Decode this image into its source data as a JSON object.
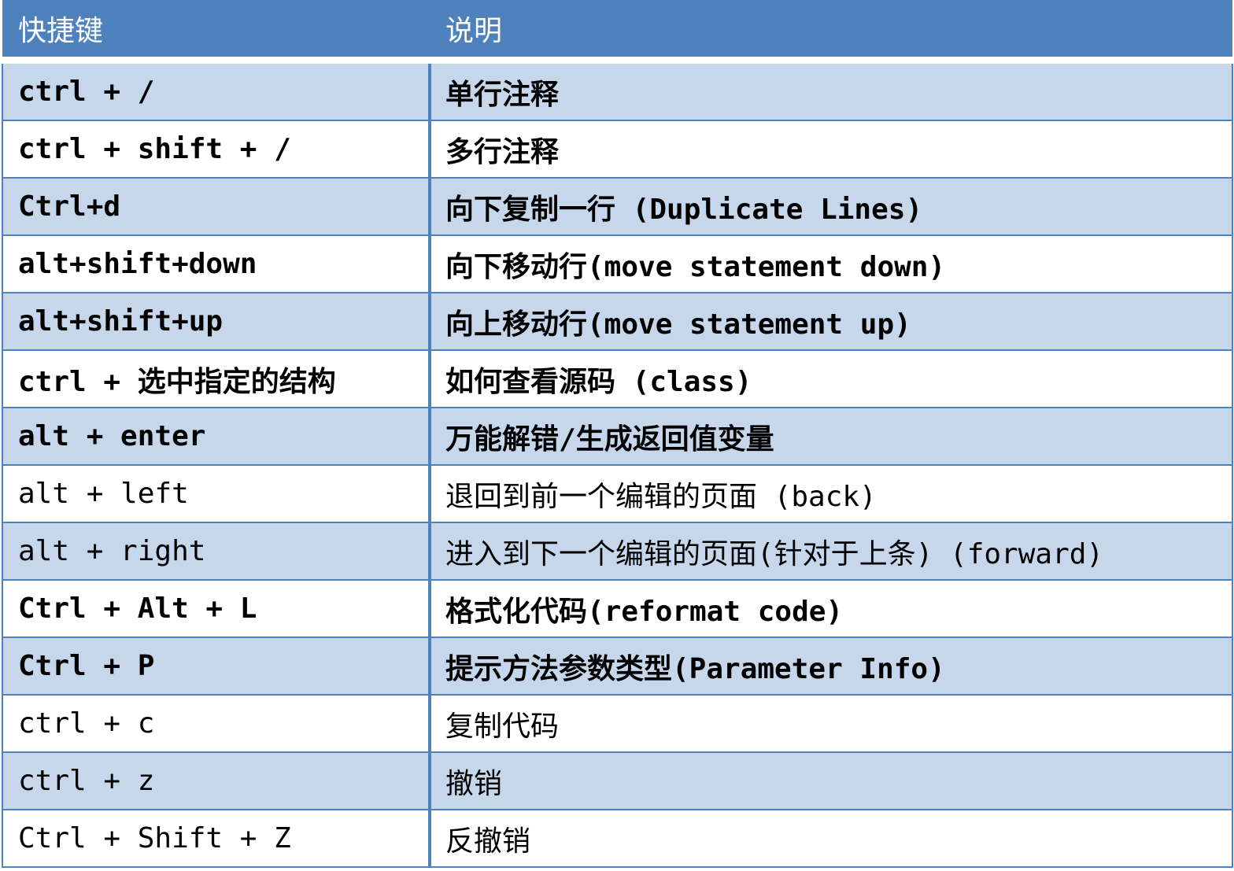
{
  "table": {
    "headers": [
      "快捷键",
      "说明"
    ],
    "rows": [
      {
        "key": "ctrl + /",
        "desc": "单行注释",
        "bold": true
      },
      {
        "key": "ctrl + shift + /",
        "desc": "多行注释",
        "bold": true
      },
      {
        "key": "Ctrl+d",
        "desc": "向下复制一行 (Duplicate Lines)",
        "bold": true
      },
      {
        "key": "alt+shift+down",
        "desc": "向下移动行(move statement down)",
        "bold": true
      },
      {
        "key": "alt+shift+up",
        "desc": "向上移动行(move statement up)",
        "bold": true
      },
      {
        "key": "ctrl + 选中指定的结构",
        "desc": "如何查看源码 (class)",
        "bold": true
      },
      {
        "key": "alt + enter",
        "desc": "万能解错/生成返回值变量",
        "bold": true
      },
      {
        "key": "alt + left",
        "desc": "退回到前一个编辑的页面 (back)",
        "bold": false
      },
      {
        "key": "alt + right",
        "desc": "进入到下一个编辑的页面(针对于上条) (forward)",
        "bold": false
      },
      {
        "key": "Ctrl + Alt + L",
        "desc": "格式化代码(reformat code)",
        "bold": true
      },
      {
        "key": "Ctrl + P",
        "desc": "提示方法参数类型(Parameter Info)",
        "bold": true
      },
      {
        "key": "ctrl + c",
        "desc": "复制代码",
        "bold": false
      },
      {
        "key": "ctrl + z",
        "desc": "撤销",
        "bold": false
      },
      {
        "key": "Ctrl + Shift + Z",
        "desc": "反撤销",
        "bold": false
      }
    ]
  },
  "colors": {
    "header_bg": "#4f81bd",
    "shaded_row_bg": "#c6d7ec",
    "plain_row_bg": "#ffffff",
    "border": "#4f81bd"
  }
}
